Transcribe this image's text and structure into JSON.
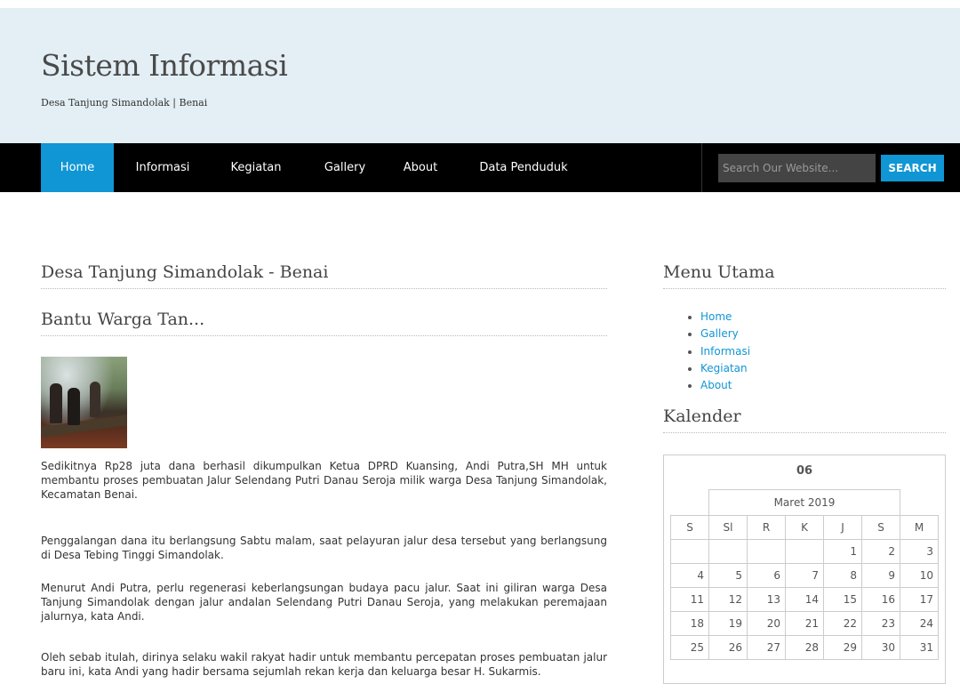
{
  "header": {
    "title": "Sistem Informasi",
    "subtitle": "Desa Tanjung Simandolak | Benai"
  },
  "nav": {
    "items": [
      "Home",
      "Informasi",
      "Kegiatan",
      "Gallery",
      "About",
      "Data Penduduk"
    ],
    "active": "Home"
  },
  "search": {
    "placeholder": "Search Our Website...",
    "button": "SEARCH"
  },
  "main": {
    "page_title": "Desa Tanjung Simandolak - Benai",
    "post_title": "Bantu Warga Tan...",
    "paragraphs": [
      "Sedikitnya Rp28 juta dana berhasil dikumpulkan Ketua DPRD Kuansing, Andi Putra,SH MH untuk membantu proses pembuatan Jalur Selendang Putri Danau Seroja milik warga Desa Tanjung Simandolak, Kecamatan Benai.",
      "Penggalangan dana itu berlangsung Sabtu malam, saat pelayuran jalur desa tersebut yang berlangsung di Desa Tebing Tinggi Simandolak.",
      "Menurut Andi Putra, perlu regenerasi keberlangsungan budaya pacu jalur. Saat ini giliran warga Desa Tanjung Simandolak dengan jalur andalan Selendang Putri Danau Seroja, yang melakukan peremajaan jalurnya, kata Andi.",
      "Oleh sebab itulah, dirinya selaku wakil rakyat hadir untuk membantu percepatan proses pembuatan jalur baru ini, kata Andi yang hadir bersama sejumlah rekan kerja dan keluarga besar H. Sukarmis."
    ]
  },
  "sidebar": {
    "menu_title": "Menu Utama",
    "menu_items": [
      "Home",
      "Gallery",
      "Informasi",
      "Kegiatan",
      "About"
    ],
    "calendar_title": "Kalender",
    "calendar": {
      "day": "06",
      "month": "Maret 2019",
      "weekdays": [
        "S",
        "Sl",
        "R",
        "K",
        "J",
        "S",
        "M"
      ],
      "weeks": [
        [
          "",
          "",
          "",
          "",
          "1",
          "2",
          "3"
        ],
        [
          "4",
          "5",
          "6",
          "7",
          "8",
          "9",
          "10"
        ],
        [
          "11",
          "12",
          "13",
          "14",
          "15",
          "16",
          "17"
        ],
        [
          "18",
          "19",
          "20",
          "21",
          "22",
          "23",
          "24"
        ],
        [
          "25",
          "26",
          "27",
          "28",
          "29",
          "30",
          "31"
        ]
      ]
    }
  },
  "colors": {
    "accent": "#1096d4",
    "header_bg": "#e3eff5",
    "nav_bg": "#000000"
  }
}
